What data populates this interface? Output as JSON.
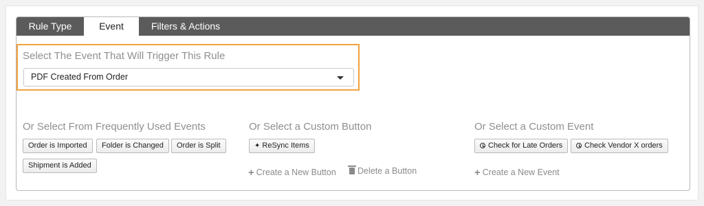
{
  "tabs": {
    "rule_type": "Rule Type",
    "event": "Event",
    "filters_actions": "Filters & Actions"
  },
  "event_select": {
    "label": "Select The Event That Will Trigger This Rule",
    "value": "PDF Created From Order"
  },
  "frequent": {
    "title": "Or Select From Frequently Used Events",
    "buttons": [
      "Order is Imported",
      "Folder is Changed",
      "Order is Split",
      "Shipment is Added"
    ]
  },
  "custom_button": {
    "title": "Or Select a Custom Button",
    "buttons": [
      "ReSync Items"
    ],
    "create_link": "Create a New Button",
    "delete_link": "Delete a Button"
  },
  "custom_event": {
    "title": "Or Select a Custom Event",
    "buttons": [
      "Check for Late Orders",
      "Check Vendor X orders"
    ],
    "create_link": "Create a New Event"
  },
  "colors": {
    "highlight": "#f0a23c",
    "tabbar": "#5b5b5b"
  },
  "icons": {
    "resync": "magic-wand-icon",
    "custom_event": "clock-icon",
    "create": "plus-icon",
    "delete": "trash-icon",
    "select": "chevron-down-icon"
  }
}
